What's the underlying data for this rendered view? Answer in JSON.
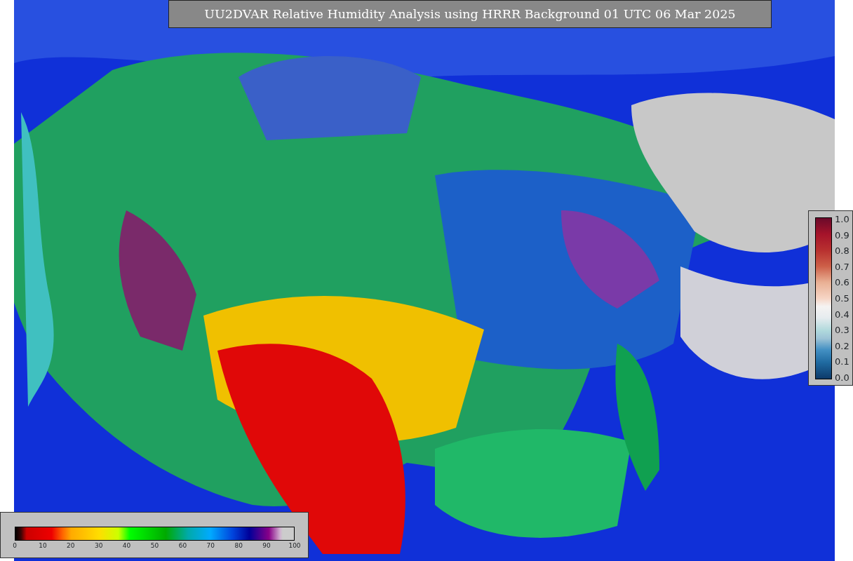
{
  "title": "UU2DVAR Relative Humidity Analysis using HRRR Background 01 UTC 06 Mar 2025",
  "ratio_colorbar": {
    "ticks": [
      "1.0",
      "0.9",
      "0.8",
      "0.7",
      "0.6",
      "0.5",
      "0.4",
      "0.3",
      "0.2",
      "0.1",
      "0.0"
    ]
  },
  "humidity_colorbar": {
    "ticks": [
      "0",
      "10",
      "20",
      "30",
      "40",
      "50",
      "60",
      "70",
      "80",
      "90",
      "100"
    ]
  }
}
